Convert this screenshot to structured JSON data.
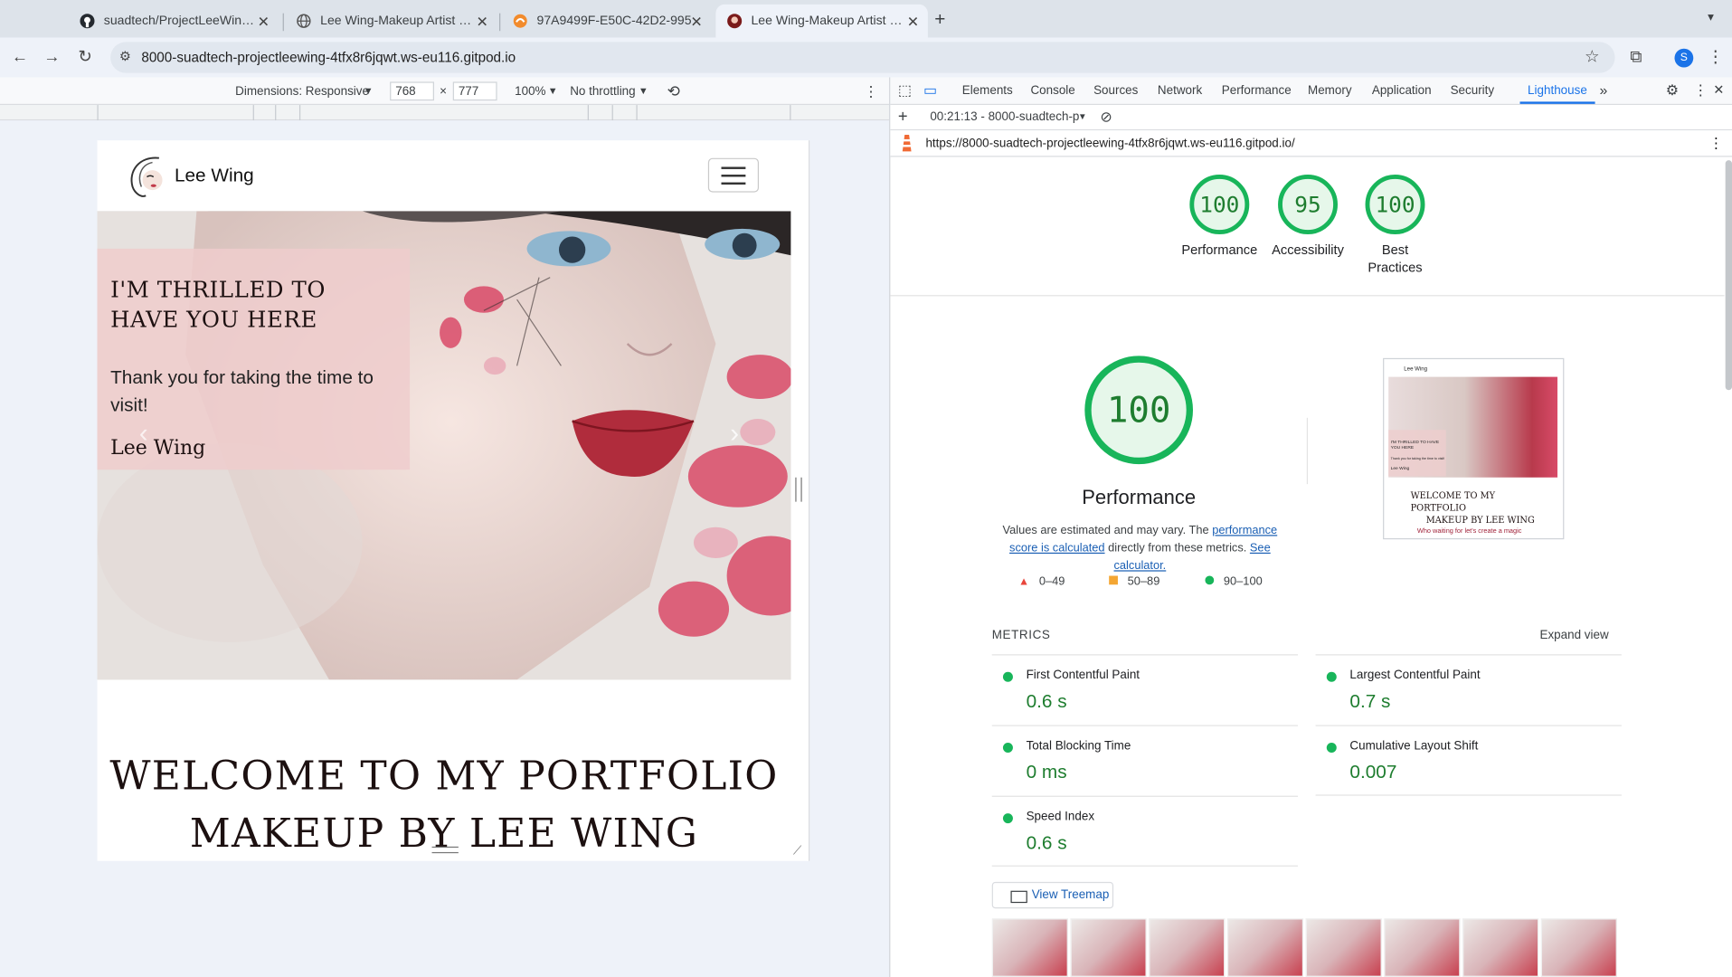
{
  "browser": {
    "tabs": [
      {
        "title": "suadtech/ProjectLeeWing: Fir",
        "icon": "github-icon"
      },
      {
        "title": "Lee Wing-Makeup Artist Portf",
        "icon": "globe-icon"
      },
      {
        "title": "97A9499F-E50C-42D2-995",
        "icon": "app-icon"
      },
      {
        "title": "Lee Wing-Makeup Artist Portf",
        "icon": "site-favicon"
      }
    ],
    "url": "8000-suadtech-projectleewing-4tfx8r6jqwt.ws-eu116.gitpod.io",
    "profile_initial": "S"
  },
  "device_toolbar": {
    "dimensions": "Dimensions: Responsive",
    "width": "768",
    "height": "777",
    "times": "×",
    "zoom": "100%",
    "throttling": "No throttling"
  },
  "page": {
    "brand": "Lee Wing",
    "hero": {
      "heading": "I'M THRILLED TO HAVE YOU HERE",
      "text": "Thank you for taking the time to visit!",
      "signature": "Lee Wing"
    },
    "welcome_line1": "WELCOME TO MY PORTFOLIO",
    "welcome_line2": "MAKEUP BY LEE WING"
  },
  "devtools": {
    "tabs": [
      "Elements",
      "Console",
      "Sources",
      "Network",
      "Performance",
      "Memory",
      "Application",
      "Security",
      "Lighthouse"
    ],
    "active_tab": "Lighthouse",
    "report_select": "00:21:13 - 8000-suadtech-p",
    "report_url": "https://8000-suadtech-projectleewing-4tfx8r6jqwt.ws-eu116.gitpod.io/",
    "scores": [
      {
        "value": "100",
        "label": "Performance"
      },
      {
        "value": "95",
        "label": "Accessibility"
      },
      {
        "value": "100",
        "label": "Best Practices"
      }
    ],
    "performance": {
      "score": "100",
      "title": "Performance",
      "desc_before": "Values are estimated and may vary. The ",
      "desc_link": "performance score is calculated",
      "desc_after": " directly from these metrics. ",
      "calc_link": "See calculator."
    },
    "legend": [
      {
        "range": "0–49",
        "color": "#e8453c"
      },
      {
        "range": "50–89",
        "color": "#f4a633"
      },
      {
        "range": "90–100",
        "color": "#18b55a"
      }
    ],
    "screenshot_preview": {
      "brand": "Lee Wing",
      "caption": "I'M THRILLED TO HAVE YOU HERE",
      "sub": "Thank you for taking the time to visit!",
      "sig": "Lee Wing",
      "welcome1": "WELCOME TO MY",
      "welcome2": "PORTFOLIO",
      "welcome3": "MAKEUP BY LEE WING",
      "tagline": "Who waiting for let's create a magic"
    },
    "metrics_label": "METRICS",
    "expand_view": "Expand view",
    "metrics": [
      {
        "name": "First Contentful Paint",
        "value": "0.6 s"
      },
      {
        "name": "Largest Contentful Paint",
        "value": "0.7 s"
      },
      {
        "name": "Total Blocking Time",
        "value": "0 ms"
      },
      {
        "name": "Cumulative Layout Shift",
        "value": "0.007"
      },
      {
        "name": "Speed Index",
        "value": "0.6 s"
      }
    ],
    "treemap_button": "View Treemap"
  }
}
